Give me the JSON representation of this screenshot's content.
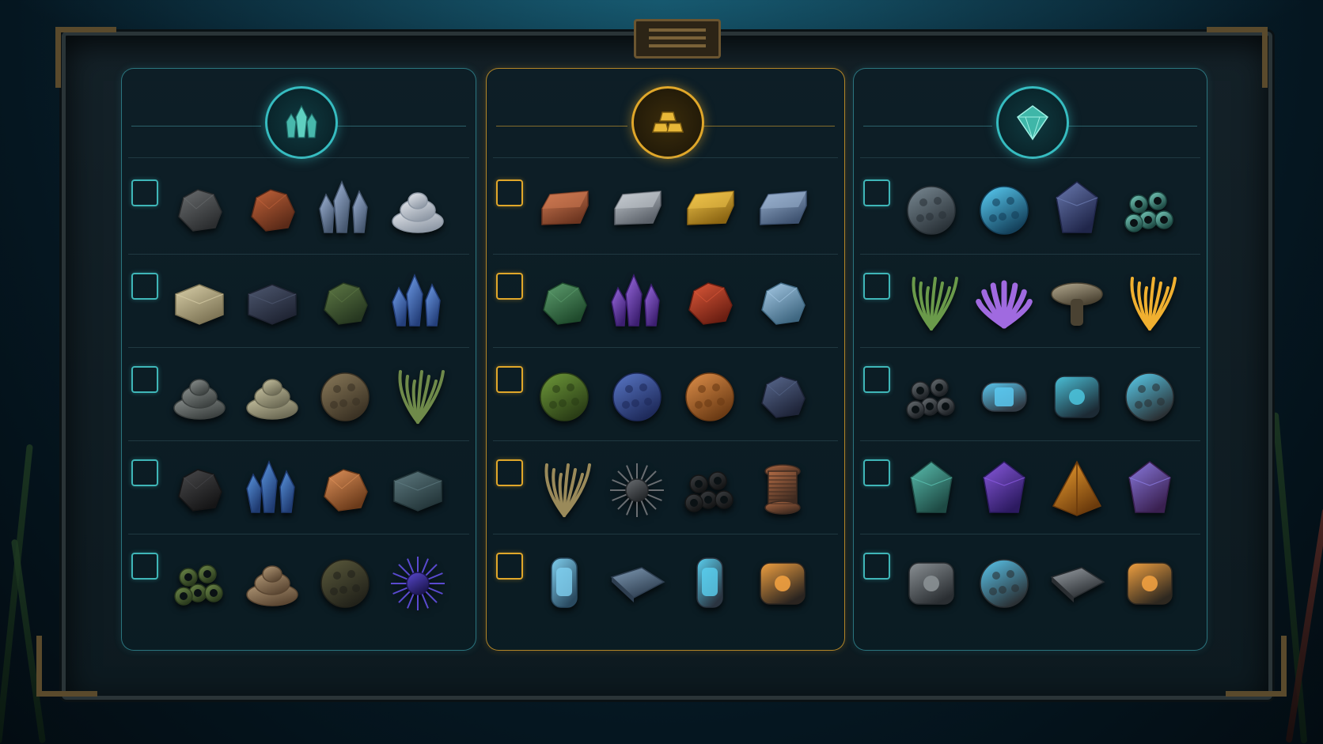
{
  "colors": {
    "teal_accent": "#3fb6b8",
    "gold_accent": "#e0a72a",
    "board": "#142128",
    "bronze": "#5a4a2c"
  },
  "panels": [
    {
      "id": "raw-materials",
      "theme": "teal",
      "icon": "crystal-cluster-icon",
      "rows": [
        {
          "checked": false,
          "items": [
            {
              "icon": "dark-stone-chunk-icon",
              "c1": "#6b6e70",
              "c2": "#2b2d2f",
              "shape": "rock"
            },
            {
              "icon": "copper-ore-chunk-icon",
              "c1": "#c4643a",
              "c2": "#5a2a18",
              "shape": "rock"
            },
            {
              "icon": "quartz-crystal-icon",
              "c1": "#9fb4d6",
              "c2": "#46576f",
              "shape": "crystal"
            },
            {
              "icon": "salt-pile-icon",
              "c1": "#e6e9ee",
              "c2": "#8e98a5",
              "shape": "pile"
            }
          ]
        },
        {
          "checked": false,
          "items": [
            {
              "icon": "limestone-block-icon",
              "c1": "#d9cfa8",
              "c2": "#7d7455",
              "shape": "block"
            },
            {
              "icon": "slate-block-icon",
              "c1": "#4e5870",
              "c2": "#1f2433",
              "shape": "block"
            },
            {
              "icon": "mossy-rock-icon",
              "c1": "#5f7a46",
              "c2": "#263720",
              "shape": "rock"
            },
            {
              "icon": "blue-crystal-icon",
              "c1": "#6f9de8",
              "c2": "#243f7a",
              "shape": "crystal"
            }
          ]
        },
        {
          "checked": false,
          "items": [
            {
              "icon": "gravel-icon",
              "c1": "#8c9290",
              "c2": "#3c4140",
              "shape": "pile"
            },
            {
              "icon": "sandstone-shards-icon",
              "c1": "#c8c3a1",
              "c2": "#6c6a55",
              "shape": "pile"
            },
            {
              "icon": "porous-rock-icon",
              "c1": "#8a7a5a",
              "c2": "#3b3224",
              "shape": "orb"
            },
            {
              "icon": "kelp-strands-icon",
              "c1": "#6f8a4a",
              "c2": "#2f3d1f",
              "shape": "plant"
            }
          ]
        },
        {
          "checked": false,
          "items": [
            {
              "icon": "coal-lump-icon",
              "c1": "#4a4a4c",
              "c2": "#151516",
              "shape": "rock"
            },
            {
              "icon": "sapphire-crystal-icon",
              "c1": "#5a96e0",
              "c2": "#1f3a70",
              "shape": "crystal"
            },
            {
              "icon": "amber-ore-icon",
              "c1": "#e0925a",
              "c2": "#6a3a1a",
              "shape": "rock"
            },
            {
              "icon": "slate-plates-icon",
              "c1": "#5e7a80",
              "c2": "#24363a",
              "shape": "block"
            }
          ]
        },
        {
          "checked": false,
          "items": [
            {
              "icon": "tube-coral-icon",
              "c1": "#6f8a4a",
              "c2": "#2a3a1d",
              "shape": "rings"
            },
            {
              "icon": "layered-shale-icon",
              "c1": "#b49a78",
              "c2": "#5a4632",
              "shape": "pile"
            },
            {
              "icon": "honeycomb-rock-icon",
              "c1": "#5b5a3c",
              "c2": "#22221a",
              "shape": "orb"
            },
            {
              "icon": "sea-urchin-icon",
              "c1": "#5a4ad0",
              "c2": "#1c1650",
              "shape": "spiky"
            }
          ]
        }
      ]
    },
    {
      "id": "refined-materials",
      "theme": "gold",
      "icon": "gold-bars-icon",
      "rows": [
        {
          "checked": false,
          "items": [
            {
              "icon": "copper-ingot-icon",
              "c1": "#d07a52",
              "c2": "#6c3520",
              "shape": "ingot"
            },
            {
              "icon": "iron-ingot-icon",
              "c1": "#c6ccd2",
              "c2": "#5a6068",
              "shape": "ingot"
            },
            {
              "icon": "gold-ingot-icon",
              "c1": "#f0c44a",
              "c2": "#8a6412",
              "shape": "ingot"
            },
            {
              "icon": "titanium-ingot-icon",
              "c1": "#9ab2d0",
              "c2": "#3e5270",
              "shape": "ingot"
            }
          ]
        },
        {
          "checked": false,
          "items": [
            {
              "icon": "emerald-ore-icon",
              "c1": "#5fa070",
              "c2": "#1f4a2c",
              "shape": "rock"
            },
            {
              "icon": "amethyst-cluster-icon",
              "c1": "#9a6ae0",
              "c2": "#3c1f70",
              "shape": "crystal"
            },
            {
              "icon": "ruby-ore-icon",
              "c1": "#e05a3a",
              "c2": "#6a1e12",
              "shape": "rock"
            },
            {
              "icon": "ice-crystal-ore-icon",
              "c1": "#a8cce8",
              "c2": "#3e6680",
              "shape": "rock"
            }
          ]
        },
        {
          "checked": false,
          "items": [
            {
              "icon": "moss-ball-icon",
              "c1": "#6f9a3a",
              "c2": "#2a3d16",
              "shape": "orb"
            },
            {
              "icon": "blue-scale-egg-icon",
              "c1": "#5a78c8",
              "c2": "#1e2a5a",
              "shape": "orb"
            },
            {
              "icon": "orange-sponge-icon",
              "c1": "#e0904a",
              "c2": "#6a3a14",
              "shape": "orb"
            },
            {
              "icon": "dark-geode-icon",
              "c1": "#5a6a90",
              "c2": "#1e2438",
              "shape": "rock"
            }
          ]
        },
        {
          "checked": false,
          "items": [
            {
              "icon": "fiber-bundle-icon",
              "c1": "#9a8a5a",
              "c2": "#3e3520",
              "shape": "plant"
            },
            {
              "icon": "wire-mesh-icon",
              "c1": "#6a6e72",
              "c2": "#24272a",
              "shape": "spiky"
            },
            {
              "icon": "rubber-hose-coil-icon",
              "c1": "#3c3f42",
              "c2": "#141516",
              "shape": "rings"
            },
            {
              "icon": "copper-wire-spool-icon",
              "c1": "#b06a44",
              "c2": "#3e2a20",
              "shape": "spool"
            }
          ]
        },
        {
          "checked": false,
          "items": [
            {
              "icon": "glass-canister-icon",
              "c1": "#7fd0f0",
              "c2": "#2a4a60",
              "shape": "canister"
            },
            {
              "icon": "metal-sheet-icon",
              "c1": "#7f9ab4",
              "c2": "#2e3e50",
              "shape": "sheet"
            },
            {
              "icon": "power-cell-icon",
              "c1": "#5ad0f0",
              "c2": "#2a3440",
              "shape": "canister"
            },
            {
              "icon": "reactor-core-icon",
              "c1": "#f0a040",
              "c2": "#2a2420",
              "shape": "device"
            }
          ]
        }
      ]
    },
    {
      "id": "advanced-components",
      "theme": "teal",
      "icon": "gem-diamond-icon",
      "rows": [
        {
          "checked": false,
          "items": [
            {
              "icon": "geodesic-sphere-icon",
              "c1": "#7a8a94",
              "c2": "#2a3238",
              "shape": "orb"
            },
            {
              "icon": "glowing-orb-cluster-icon",
              "c1": "#5ad0f8",
              "c2": "#14405a",
              "shape": "orb"
            },
            {
              "icon": "faceted-dark-gem-icon",
              "c1": "#6a7ab0",
              "c2": "#20264a",
              "shape": "gem"
            },
            {
              "icon": "bubble-cluster-icon",
              "c1": "#7ad0c0",
              "c2": "#1e4a44",
              "shape": "rings"
            }
          ]
        },
        {
          "checked": false,
          "items": [
            {
              "icon": "seaweed-frond-icon",
              "c1": "#6a9a4a",
              "c2": "#24401a",
              "shape": "plant"
            },
            {
              "icon": "purple-fan-coral-icon",
              "c1": "#a06ae0",
              "c2": "#3c1f70",
              "shape": "fan"
            },
            {
              "icon": "mushroom-icon",
              "c1": "#b4aa90",
              "c2": "#4a4232",
              "shape": "mushroom"
            },
            {
              "icon": "glowing-coral-icon",
              "c1": "#f0b030",
              "c2": "#6a4010",
              "shape": "plant"
            }
          ]
        },
        {
          "checked": false,
          "items": [
            {
              "icon": "metal-ring-icon",
              "c1": "#6a7074",
              "c2": "#1e2226",
              "shape": "rings"
            },
            {
              "icon": "energy-cylinder-icon",
              "c1": "#5ac8f0",
              "c2": "#303a44",
              "shape": "cylinder"
            },
            {
              "icon": "tech-cube-icon",
              "c1": "#4ac0d8",
              "c2": "#1c2a34",
              "shape": "device"
            },
            {
              "icon": "orb-drone-icon",
              "c1": "#5ad0f0",
              "c2": "#2a3034",
              "shape": "orb"
            }
          ]
        },
        {
          "checked": false,
          "items": [
            {
              "icon": "teal-crystal-shard-icon",
              "c1": "#5ac0b0",
              "c2": "#1e4a44",
              "shape": "gem"
            },
            {
              "icon": "violet-crystal-shard-icon",
              "c1": "#8a5ae0",
              "c2": "#2c1a60",
              "shape": "gem"
            },
            {
              "icon": "amber-pyramid-icon",
              "c1": "#f0a030",
              "c2": "#6a3a0c",
              "shape": "pyramid"
            },
            {
              "icon": "prismatic-cube-icon",
              "c1": "#8a7ae0",
              "c2": "#3a2050",
              "shape": "gem"
            }
          ]
        },
        {
          "checked": false,
          "items": [
            {
              "icon": "engine-module-icon",
              "c1": "#8a9094",
              "c2": "#2a2e32",
              "shape": "device"
            },
            {
              "icon": "helmet-module-icon",
              "c1": "#5ac8f0",
              "c2": "#2a3034",
              "shape": "orb"
            },
            {
              "icon": "circuit-board-icon",
              "c1": "#9aa0a6",
              "c2": "#2a2e32",
              "shape": "sheet"
            },
            {
              "icon": "glowing-core-box-icon",
              "c1": "#f0a040",
              "c2": "#2e2820",
              "shape": "device"
            }
          ]
        }
      ]
    }
  ]
}
